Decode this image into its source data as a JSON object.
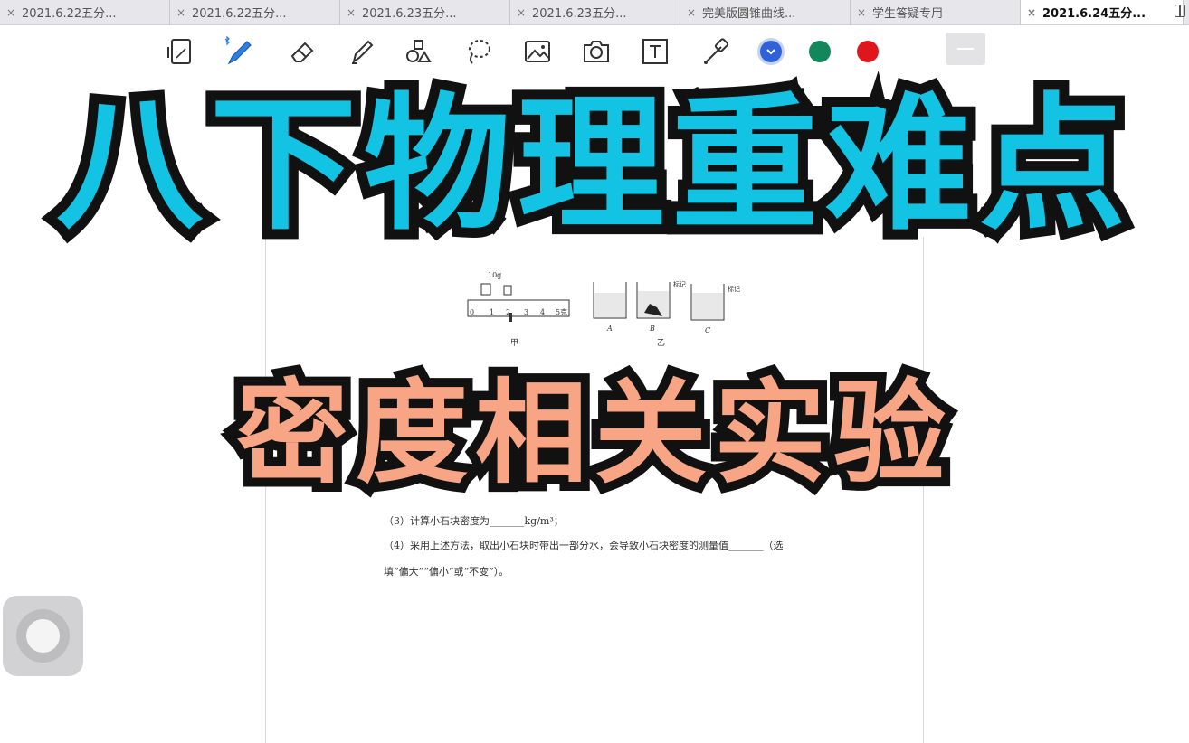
{
  "tabs": [
    {
      "label": "2021.6.22五分...",
      "active": false
    },
    {
      "label": "2021.6.22五分...",
      "active": false
    },
    {
      "label": "2021.6.23五分...",
      "active": false
    },
    {
      "label": "2021.6.23五分...",
      "active": false
    },
    {
      "label": "完美版圆锥曲线...",
      "active": false
    },
    {
      "label": "学生答疑专用",
      "active": false
    },
    {
      "label": "2021.6.24五分...",
      "active": true
    }
  ],
  "tab_close_glyph": "×",
  "toolbar": {
    "icons": [
      "tablet-icon",
      "bluetooth-pen-icon",
      "eraser-icon",
      "highlighter-icon",
      "shapes-icon",
      "lasso-icon",
      "image-icon",
      "camera-icon",
      "textbox-icon",
      "laser-pointer-icon"
    ],
    "colors": [
      "#2f62d6",
      "#11875a",
      "#e0161d"
    ],
    "selected_color": "#2f62d6"
  },
  "title": {
    "main": "八下物理重难点",
    "sub": "密度相关实验",
    "main_color": "#12c3e3",
    "sub_color": "#f7a584"
  },
  "document": {
    "fig_left_weights": "10g",
    "scale_numbers": [
      "0",
      "1",
      "2",
      "3",
      "4",
      "5克"
    ],
    "beaker_labels": [
      "A",
      "B",
      "C"
    ],
    "mark_label": "标记",
    "caption_left": "甲",
    "caption_right": "乙",
    "line1": "（3）计算小石块密度为_______kg/m³；",
    "line2": "（4）采用上述方法，取出小石块时带出一部分水，会导致小石块密度的测量值_______（选",
    "line3": "填“偏大”“偏小”或“不变”）。"
  }
}
